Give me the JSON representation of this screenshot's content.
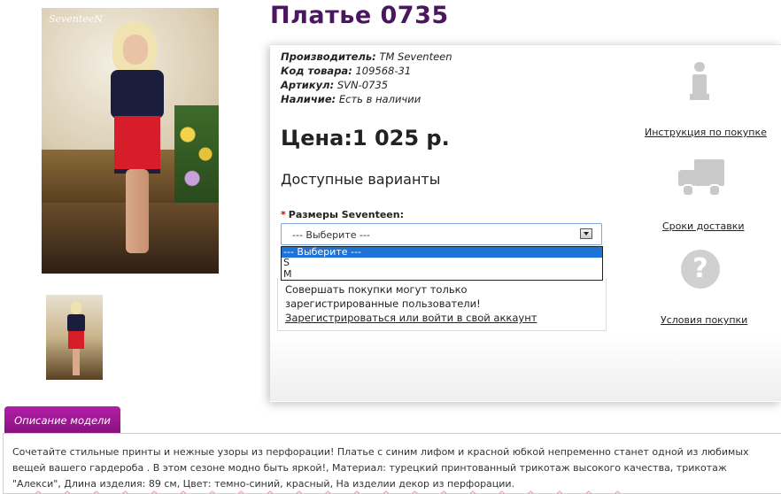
{
  "product": {
    "title": "Платье 0735",
    "watermark": "SeventeeN",
    "info": [
      {
        "label": "Производитель:",
        "value": "TM Seventeen"
      },
      {
        "label": "Код товара:",
        "value": "109568-31"
      },
      {
        "label": "Артикул:",
        "value": "SVN-0735"
      },
      {
        "label": "Наличие:",
        "value": "Есть в наличии"
      }
    ],
    "price": "Цена:1 025 р.",
    "variants_heading": "Доступные варианты",
    "size": {
      "required_mark": "*",
      "label": "Размеры Seventeen:",
      "selected": "--- Выберите ---",
      "options": [
        "--- Выберите ---",
        "S",
        "M"
      ]
    },
    "notice": {
      "text": "Совершать покупки могут только зарегистрированные пользователи!",
      "link": "Зарегистрироваться или войти в свой аккаунт"
    }
  },
  "sidebar": {
    "instruction": "Инструкция по покупке",
    "delivery": "Сроки доставки",
    "conditions": "Условия покупки",
    "help_symbol": "?"
  },
  "description": {
    "tab": "Описание модели",
    "text": "Сочетайте стильные принты и нежные узоры из перфорации! Платье с синим лифом и красной юбкой непременно станет одной из любимых вещей вашего гардероба . В этом сезоне модно быть яркой!, Материал: турецкий принтованный трикотаж высокого качества, трикотаж \"Алекси\", Длина изделия: 89 см, Цвет: темно-синий, красный, На изделии декор из перфорации."
  },
  "colors": {
    "title": "#4b1560",
    "tab": "#9c1892",
    "select_highlight": "#1e73d6"
  }
}
